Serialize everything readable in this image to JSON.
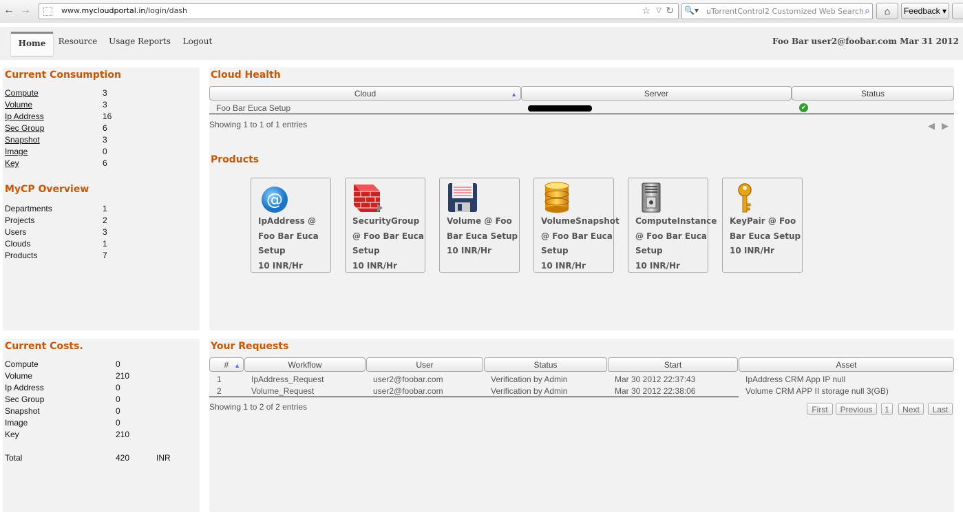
{
  "browser": {
    "url_prefix": "www.",
    "url_domain": "mycloudportal.in",
    "url_path": "/login/dash",
    "search_placeholder": "uTorrentControl2 Customized Web Search",
    "feedback_label": "Feedback"
  },
  "nav": {
    "tabs": [
      {
        "label": "Home",
        "active": true
      },
      {
        "label": "Resource"
      },
      {
        "label": "Usage Reports"
      },
      {
        "label": "Logout"
      }
    ],
    "user_info": "Foo Bar user2@foobar.com Mar 31 2012"
  },
  "consumption": {
    "title": "Current Consumption",
    "rows": [
      {
        "label": "Compute",
        "value": "3"
      },
      {
        "label": "Volume",
        "value": "3"
      },
      {
        "label": "Ip Address",
        "value": "16"
      },
      {
        "label": "Sec Group",
        "value": "6"
      },
      {
        "label": "Snapshot",
        "value": "3"
      },
      {
        "label": "Image",
        "value": "0"
      },
      {
        "label": "Key",
        "value": "6"
      }
    ]
  },
  "overview": {
    "title": "MyCP Overview",
    "rows": [
      {
        "label": "Departments",
        "value": "1"
      },
      {
        "label": "Projects",
        "value": "2"
      },
      {
        "label": "Users",
        "value": "3"
      },
      {
        "label": "Clouds",
        "value": "1"
      },
      {
        "label": "Products",
        "value": "7"
      }
    ]
  },
  "costs": {
    "title": "Current Costs.",
    "rows": [
      {
        "label": "Compute",
        "value": "0"
      },
      {
        "label": "Volume",
        "value": "210"
      },
      {
        "label": "Ip Address",
        "value": "0"
      },
      {
        "label": "Sec Group",
        "value": "0"
      },
      {
        "label": "Snapshot",
        "value": "0"
      },
      {
        "label": "Image",
        "value": "0"
      },
      {
        "label": "Key",
        "value": "210"
      }
    ],
    "total_label": "Total",
    "total_value": "420",
    "currency": "INR"
  },
  "cloud_health": {
    "title": "Cloud Health",
    "columns": [
      "Cloud",
      "Server",
      "Status"
    ],
    "rows": [
      {
        "cloud": "Foo Bar Euca Setup",
        "status": "ok"
      }
    ],
    "info": "Showing 1 to 1 of 1 entries"
  },
  "products": {
    "title": "Products",
    "items": [
      {
        "name": "IpAddress @ Foo Bar Euca Setup",
        "lines": [
          "IpAddress @",
          "Foo Bar Euca",
          "Setup"
        ],
        "price": "10 INR/Hr",
        "icon": "at-sign-icon"
      },
      {
        "name": "SecurityGroup @ Foo Bar Euca Setup",
        "lines": [
          "SecurityGroup",
          "@ Foo Bar Euca",
          "Setup"
        ],
        "price": "10 INR/Hr",
        "icon": "firewall-icon"
      },
      {
        "name": "Volume @ Foo Bar Euca Setup",
        "lines": [
          "Volume @ Foo",
          "Bar Euca Setup"
        ],
        "price": "10 INR/Hr",
        "icon": "floppy-disk-icon"
      },
      {
        "name": "VolumeSnapshot @ Foo Bar Euca Setup",
        "lines": [
          "VolumeSnapshot",
          "@ Foo Bar Euca",
          "Setup"
        ],
        "price": "10 INR/Hr",
        "icon": "database-icon"
      },
      {
        "name": "ComputeInstance @ Foo Bar Euca Setup",
        "lines": [
          "ComputeInstance",
          "@ Foo Bar Euca",
          "Setup"
        ],
        "price": "10 INR/Hr",
        "icon": "server-icon"
      },
      {
        "name": "KeyPair @ Foo Bar Euca Setup",
        "lines": [
          "KeyPair @ Foo",
          "Bar Euca Setup"
        ],
        "price": "10 INR/Hr",
        "icon": "key-icon"
      }
    ]
  },
  "requests": {
    "title": "Your Requests",
    "columns": [
      "#",
      "Workflow",
      "User",
      "Status",
      "Start",
      "Asset"
    ],
    "rows": [
      {
        "num": "1",
        "workflow": "IpAddress_Request",
        "user": "user2@foobar.com",
        "status": "Verification by Admin",
        "start": "Mar 30 2012 22:37:43",
        "asset": "IpAddress CRM App IP null"
      },
      {
        "num": "2",
        "workflow": "Volume_Request",
        "user": "user2@foobar.com",
        "status": "Verification by Admin",
        "start": "Mar 30 2012 22:38:06",
        "asset": "Volume CRM APP II storage null 3(GB)"
      }
    ],
    "info": "Showing 1 to 2 of 2 entries",
    "pager": {
      "first": "First",
      "previous": "Previous",
      "page": "1",
      "next": "Next",
      "last": "Last"
    }
  }
}
